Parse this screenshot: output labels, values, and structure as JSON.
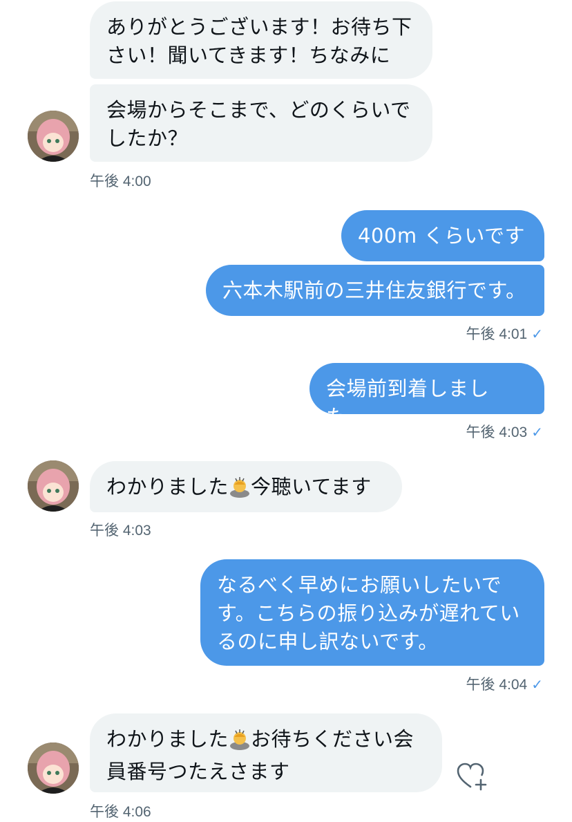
{
  "messages": [
    {
      "side": "in",
      "text": "ありがとうございます！お待ち下さい！聞いてきます！ちなみに",
      "lines": [
        "ありがとうございます！お待ち下",
        "さい！聞いてきます！ちなみに"
      ]
    },
    {
      "side": "in",
      "lines": [
        "会場からそこまで、どのくらいで",
        "したか？"
      ],
      "time": "午後 4:00"
    },
    {
      "side": "out",
      "lines": [
        "400m くらいです"
      ]
    },
    {
      "side": "out",
      "lines": [
        "六本木駅前の三井住友銀行です。"
      ],
      "time": "午後 4:01"
    },
    {
      "side": "out",
      "lines": [
        "会場前到着しました。"
      ],
      "time": "午後 4:03"
    },
    {
      "side": "in",
      "pre": "わかりました",
      "post": "今聴いてます",
      "emoji": "person-bowing-emoji",
      "time": "午後 4:03"
    },
    {
      "side": "out",
      "lines": [
        "なるべく早めにお願いしたいで",
        "す。こちらの振り込みが遅れてい",
        "るのに申し訳ないです。"
      ],
      "time": "午後 4:04"
    },
    {
      "side": "in",
      "pre": "わかりました",
      "post": "お待ちください会",
      "line2": "員番号つたえさます",
      "emoji": "person-bowing-emoji",
      "time": "午後 4:06"
    }
  ],
  "read_receipt_icon": "checkmark-icon",
  "colors": {
    "outgoing": "#4c98e8",
    "incoming": "#eff3f4",
    "timestamp": "#536471"
  }
}
